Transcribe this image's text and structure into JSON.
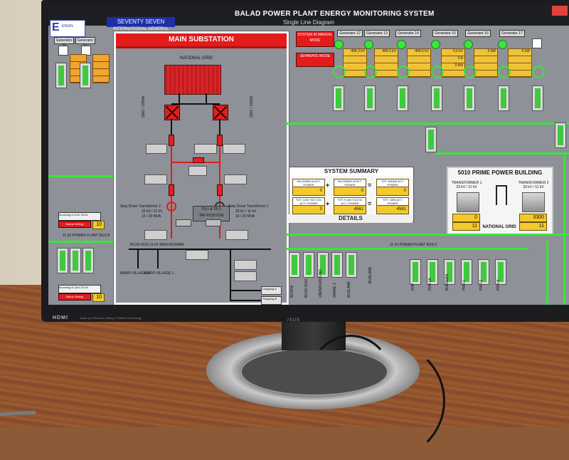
{
  "app": {
    "title": "BALAD POWER PLANT ENERGY MONITORING SYSTEM",
    "subtitle": "Single Line Diagram",
    "client": "SEVENTY SEVEN",
    "client_sub": "INTERNATIONAL GENERAL",
    "logo": "E"
  },
  "popup": {
    "title": "MAIN SUBSTATION",
    "national_grid": "NATIONAL GRID",
    "left_breaker": "33kV / 1250A",
    "right_breaker": "33kV / 1250A",
    "tap_title": "TR.1 & TR.2",
    "tap_sub": "TAP POSITION",
    "step_down_2": "Step Down Transformer 2",
    "step_down_2_rating": "33 kV / 11 kV",
    "step_down_2_mva": "15 / 20 MVA",
    "step_down_1": "Step Down Transformer 1",
    "step_down_1_rating": "33 kV / 11 kV",
    "step_down_1_mva": "15 / 20 MVA",
    "bus_label": "BLDG 5010 11 kV MAIN BUSBAR",
    "feeder_left": "BAKIR VILLAGE 2",
    "feeder_right": "BAKIR VILLAGE 1",
    "outgoing_a": "Outgoing A",
    "outgoing_a_rating": "11kV 33 kV",
    "outgoing_b": "Outgoing B",
    "outgoing_b_rating": "11kV 33 kV"
  },
  "mode": {
    "manual": "SYSTEM IN MANUAL MODE",
    "separate": "SEPARATE MODE"
  },
  "generators": {
    "labels": [
      "Generator 20",
      "Generator 21",
      "Generator 12",
      "Generator 13",
      "Generator 14",
      "Generator 15",
      "Generator 16",
      "Generator 17"
    ],
    "values": [
      "404.3 kV",
      "404.5 kV",
      "404.5 kV",
      "0.0 kV",
      "0 A",
      "0 kW",
      "0 kW",
      "0 kW"
    ]
  },
  "buses": {
    "left_bus": "11 kV POWER PLANT BUS B",
    "right_bus": "11 kV POWER PLANT BUS C"
  },
  "feeders": [
    "BUSRA",
    "BLDG 5010",
    "UNDERGROUND",
    "SPARE 1",
    "BUSLANK",
    "BUSLANK",
    "PHP",
    "FDB-1A",
    "BURAMIN",
    "PRO-1",
    "PRO-2",
    "PRO-3"
  ],
  "summary": {
    "title": "SYSTEM SUMMARY",
    "incoming_a": "INCOMING A ACT. POWER",
    "incoming_a_val": "0",
    "incoming_b": "INCOMING B ACT. POWER",
    "incoming_b_val": "0",
    "mains_total": "TOT. MAINS ACT. POWER",
    "mains_total_val": "0",
    "gen_11kv": "TOT. 11kV G21 G21 ACT. POWER",
    "gen_11kv_val": "0",
    "gen_04kv": "TOT. 0.4kV G13 G2 ACT. POWER",
    "gen_04kv_val": "4561",
    "gen_total": "TOT. GEN ACT. POWER",
    "gen_total_val": "4561",
    "unit": "kW",
    "details": "DETAILS"
  },
  "prime": {
    "title": "5010 PRIME POWER BUILDING",
    "tr1": "TRANSFORMER 1",
    "tr1_rating": "33 kV / 11 kV",
    "tr2": "TRANSFORMER 2",
    "tr2_rating": "33 kV / 11 kV",
    "val1": "0",
    "val2": "11",
    "val3": "3300",
    "val4": "11",
    "unit_kw": "kW",
    "unit_kv": "kV",
    "grid": "NATIONAL GRID"
  },
  "side": {
    "incoming_a": "Incoming A 11kV 33 kV",
    "mains_setting": "Mains Setting",
    "incoming_b": "Incoming B 11kV 33 kV",
    "mains_setting_b": "Mains Setting",
    "value_a": "10",
    "value_b": "10"
  },
  "monitor": {
    "hdmi": "HDMI",
    "audio": "Audio by ICEpower  |  Bang & Olufsen Technology",
    "brand": "/SUS"
  },
  "colors": {
    "alarm_red": "#e31b1b",
    "live_green": "#39e639",
    "value_yellow": "#f3c92c",
    "scada_grey": "#8e9198"
  }
}
